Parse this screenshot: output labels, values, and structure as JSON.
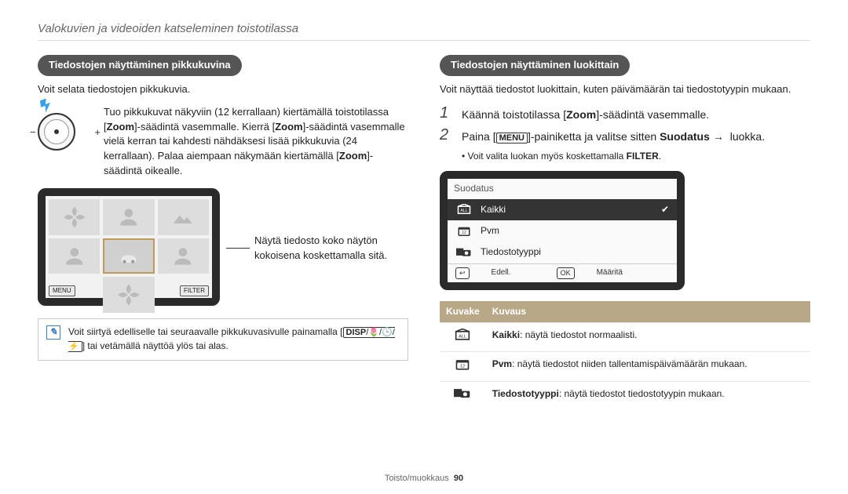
{
  "header": {
    "title": "Valokuvien ja videoiden katseleminen toistotilassa"
  },
  "left": {
    "pill": "Tiedostojen näyttäminen pikkukuvina",
    "intro": "Voit selata tiedostojen pikkukuvia.",
    "dial_text_1": "Tuo pikkukuvat näkyviin (12 kerrallaan) kiertämällä toistotilassa [",
    "dial_text_2": "Zoom",
    "dial_text_3": "]-säädintä vasemmalle. Kierrä [",
    "dial_text_4": "Zoom",
    "dial_text_5": "]-säädintä vasemmalle vielä kerran tai kahdesti nähdäksesi lisää pikkukuvia (24 kerrallaan). Palaa aiempaan näkymään kiertämällä [",
    "dial_text_6": "Zoom",
    "dial_text_7": "]-säädintä oikealle.",
    "screen": {
      "menu": "MENU",
      "filter": "FILTER"
    },
    "callout": "Näytä tiedosto koko näytön kokoisena koskettamalla sitä.",
    "note_1": "Voit siirtyä edelliselle tai seuraavalle pikkukuvasivulle painamalla [",
    "note_disp": "DISP",
    "note_sep1": "/",
    "note_macro": "🌷",
    "note_sep2": "/",
    "note_timer": "🕒",
    "note_sep3": "/",
    "note_flash": "⚡",
    "note_2": "] tai vetämällä näyttöä ylös tai alas."
  },
  "right": {
    "pill": "Tiedostojen näyttäminen luokittain",
    "intro": "Voit näyttää tiedostot luokittain, kuten päivämäärän tai tiedostotyypin mukaan.",
    "step1_a": "Käännä toistotilassa [",
    "step1_zoom": "Zoom",
    "step1_b": "]-säädintä vasemmalle.",
    "step2_a": "Paina [",
    "step2_menu": "MENU",
    "step2_b": "]-painiketta ja valitse sitten ",
    "step2_suodatus": "Suodatus",
    "step2_arrow": "→",
    "step2_c": " luokka.",
    "substep_a": "Voit valita luokan myös koskettamalla ",
    "substep_filter": "FILTER",
    "substep_b": ".",
    "filter_screen": {
      "title": "Suodatus",
      "row_all": "Kaikki",
      "row_date": "Pvm",
      "row_type": "Tiedostotyyppi",
      "back": "Edell.",
      "ok": "OK",
      "set": "Määritä"
    },
    "table": {
      "h1": "Kuvake",
      "h2": "Kuvaus",
      "r1_term": "Kaikki",
      "r1_desc": ": näytä tiedostot normaalisti.",
      "r2_term": "Pvm",
      "r2_desc": ": näytä tiedostot niiden tallentamispäivämäärän mukaan.",
      "r3_term": "Tiedostotyyppi",
      "r3_desc": ": näytä tiedostot tiedostotyypin mukaan."
    }
  },
  "footer": {
    "section": "Toisto/muokkaus",
    "page": "90"
  }
}
